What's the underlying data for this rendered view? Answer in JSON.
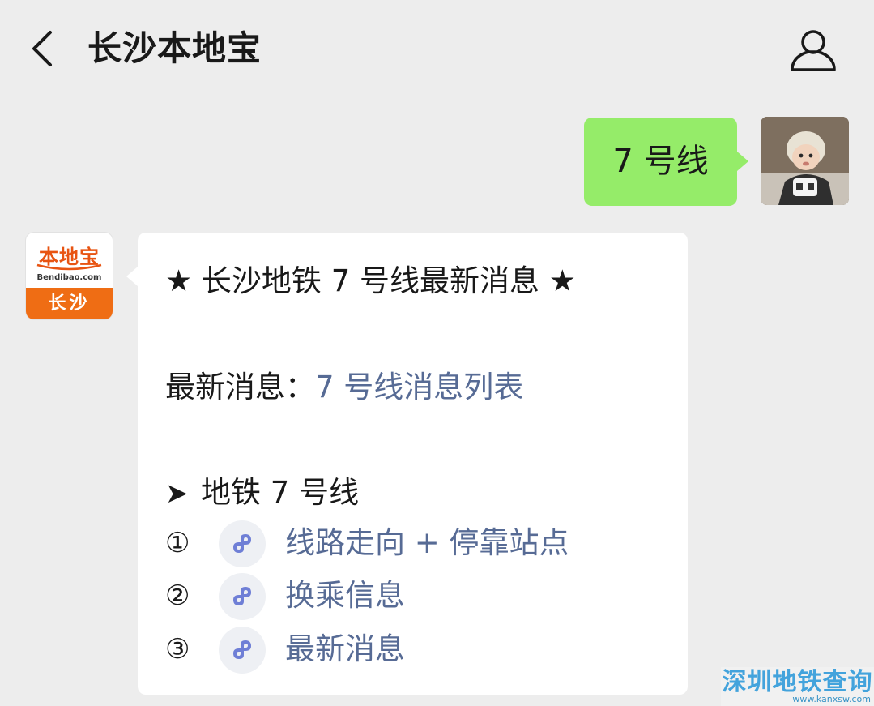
{
  "header": {
    "back_icon": "chevron-left-icon",
    "title": "长沙本地宝",
    "profile_icon": "person-icon"
  },
  "messages": {
    "outgoing": {
      "text": "7 号线"
    },
    "incoming": {
      "brand_logo_text": "本地宝",
      "brand_logo_domain": "Bendibao.com",
      "brand_logo_city": "长沙",
      "headline": "★ 长沙地铁 7 号线最新消息 ★",
      "news_label": "最新消息：",
      "news_link": "7 号线消息列表",
      "section_arrow": "➤",
      "section_title": "地铁 7 号线",
      "items": [
        {
          "num": "①",
          "label": "线路走向 + 停靠站点"
        },
        {
          "num": "②",
          "label": "换乘信息"
        },
        {
          "num": "③",
          "label": "最新消息"
        }
      ]
    }
  },
  "watermark": {
    "main": "深圳地铁查询",
    "sub": "www.kanxsw.com"
  },
  "colors": {
    "background": "#ededed",
    "outgoing_bubble": "#95ec69",
    "incoming_bubble": "#ffffff",
    "link": "#576b95",
    "brand_orange": "#ef6d14"
  }
}
